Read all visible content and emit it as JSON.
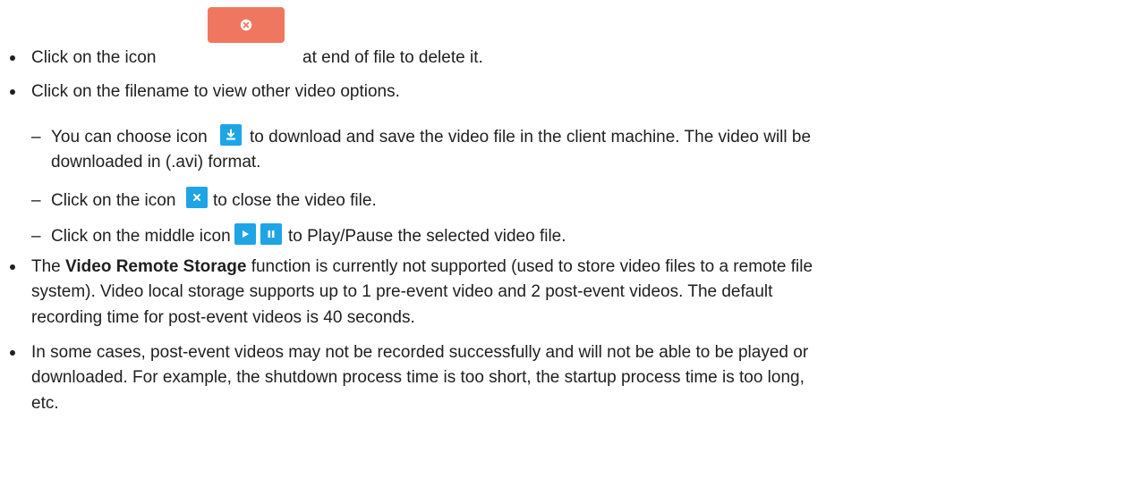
{
  "colors": {
    "delete_icon_bg": "#f0775f",
    "blue_icon_bg": "#1ea5e6",
    "text": "#1f1f1f"
  },
  "icons": {
    "delete": "close-circle-icon",
    "download": "download-icon",
    "close": "close-icon",
    "play": "play-icon",
    "pause": "pause-icon"
  },
  "items": {
    "delete": {
      "before": "Click on the icon",
      "after": "at end of file to delete it."
    },
    "filename": {
      "text": "Click on the filename to view other video options."
    },
    "download": {
      "dash": "–",
      "before": "You can choose icon",
      "after": "to download and save the video file in the client machine. The video will be",
      "line2": "downloaded in (.avi) format."
    },
    "close": {
      "dash": "–",
      "before": "Click on the icon",
      "after": "to close the video file."
    },
    "play": {
      "dash": "–",
      "before": "Click on the middle icon",
      "after": "to Play/Pause the selected video file."
    },
    "storage": {
      "bold": "Video Remote Storage",
      "line1_prefix": "The",
      "line1_suffix": "function is currently not supported (used to store video files to a remote file",
      "line2": "system). Video local storage supports up to 1 pre-event video and 2 post-event videos. The default",
      "line3": "recording time for post-event videos is 40 seconds."
    },
    "cases": {
      "line1": "In some cases, post-event videos may not be recorded successfully and will not be able to be played or",
      "line2": "downloaded. For example, the shutdown process time is too short, the startup process time is too long,",
      "line3": "etc."
    }
  }
}
